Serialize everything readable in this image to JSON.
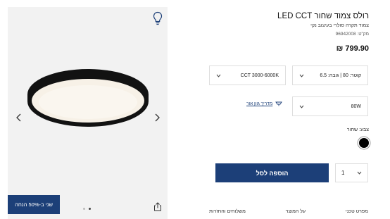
{
  "gallery": {
    "sale_badge": "שני ב-50% הנחה",
    "dots_count": 2,
    "active_dot": 2
  },
  "product": {
    "title": "רולס צמוד שחור LED CCT",
    "subtitle": "צמוד תקרה סולרי בעיצוב נקי",
    "sku": "מק\"ט: 96942008",
    "price": "799.90 ₪"
  },
  "options": {
    "dimensions": "קוטר: 80 | גובה: 6.5",
    "cct": "CCT 3000-6000K",
    "wattage": "80W",
    "light_guide": "מדריך גוון אור"
  },
  "color": {
    "label": "צבע: שחור",
    "swatch_hex": "#000000"
  },
  "cart": {
    "quantity": "1",
    "add_label": "הוספה לסל"
  },
  "tabs": [
    "מפרט טכני",
    "על המוצר",
    "משלוחים והחזרות"
  ],
  "colors": {
    "accent": "#1c3f78",
    "gallery_bg": "#f2f2f2"
  }
}
